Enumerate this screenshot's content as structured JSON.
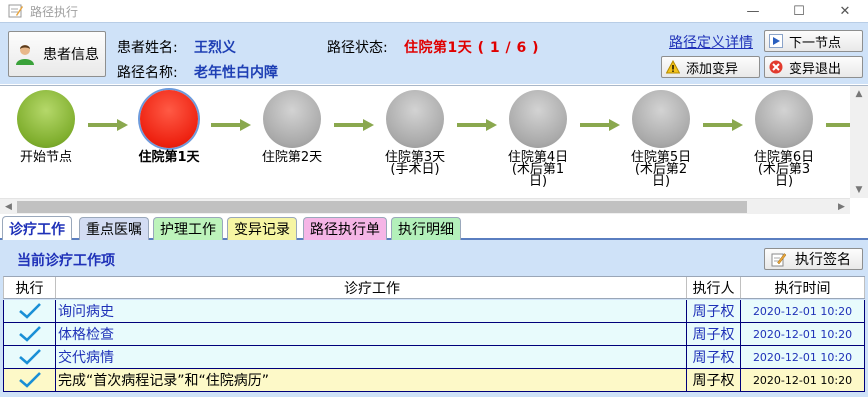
{
  "window": {
    "title": "路径执行",
    "minimize_glyph": "—",
    "maximize_glyph": "☐",
    "close_glyph": "✕"
  },
  "header": {
    "patient_button": "患者信息",
    "patient_name_label": "患者姓名:",
    "patient_name": "王烈义",
    "path_name_label": "路径名称:",
    "path_name": "老年性白内障",
    "path_status_label": "路径状态:",
    "path_status": "住院第1天 ( 1 / 6 )",
    "definition_link": "路径定义详情",
    "next_node_button": "下一节点",
    "add_variation_button": "添加变异",
    "variation_exit_button": "变异退出"
  },
  "flow": {
    "nodes": [
      {
        "label": "开始节点",
        "state": "done"
      },
      {
        "label": "住院第1天",
        "state": "current"
      },
      {
        "label": "住院第2天",
        "state": "pending"
      },
      {
        "label": "住院第3天\n(手术日)",
        "state": "pending"
      },
      {
        "label": "住院第4日\n(术后第1\n日)",
        "state": "pending"
      },
      {
        "label": "住院第5日\n(术后第2\n日)",
        "state": "pending"
      },
      {
        "label": "住院第6日\n(术后第3\n日)",
        "state": "pending"
      }
    ]
  },
  "tabs": [
    {
      "label": "诊疗工作",
      "color": "#ffffff",
      "active": true
    },
    {
      "label": "重点医嘱",
      "color": "#d3dcf3",
      "active": false
    },
    {
      "label": "护理工作",
      "color": "#bdf3bb",
      "active": false
    },
    {
      "label": "变异记录",
      "color": "#f6f5a3",
      "active": false
    },
    {
      "label": "路径执行单",
      "color": "#f5b5e6",
      "active": false
    },
    {
      "label": "执行明细",
      "color": "#b3f0ba",
      "active": false
    }
  ],
  "content": {
    "section_title": "当前诊疗工作项",
    "sign_button": "执行签名",
    "columns": {
      "exec": "执行",
      "work": "诊疗工作",
      "person": "执行人",
      "time": "执行时间"
    },
    "rows": [
      {
        "done": true,
        "work": "询问病史",
        "person": "周子权",
        "time": "2020-12-01 10:20",
        "highlight": false
      },
      {
        "done": true,
        "work": "体格检查",
        "person": "周子权",
        "time": "2020-12-01 10:20",
        "highlight": false
      },
      {
        "done": true,
        "work": "交代病情",
        "person": "周子权",
        "time": "2020-12-01 10:20",
        "highlight": false
      },
      {
        "done": true,
        "work": "完成“首次病程记录”和“住院病历”",
        "person": "周子权",
        "time": "2020-12-01 10:20",
        "highlight": true
      }
    ]
  },
  "colors": {
    "panel_bg": "#cfe2f8",
    "link_blue": "#1f31b8",
    "status_red": "#e00000",
    "check_blue": "#1a8fd6"
  }
}
